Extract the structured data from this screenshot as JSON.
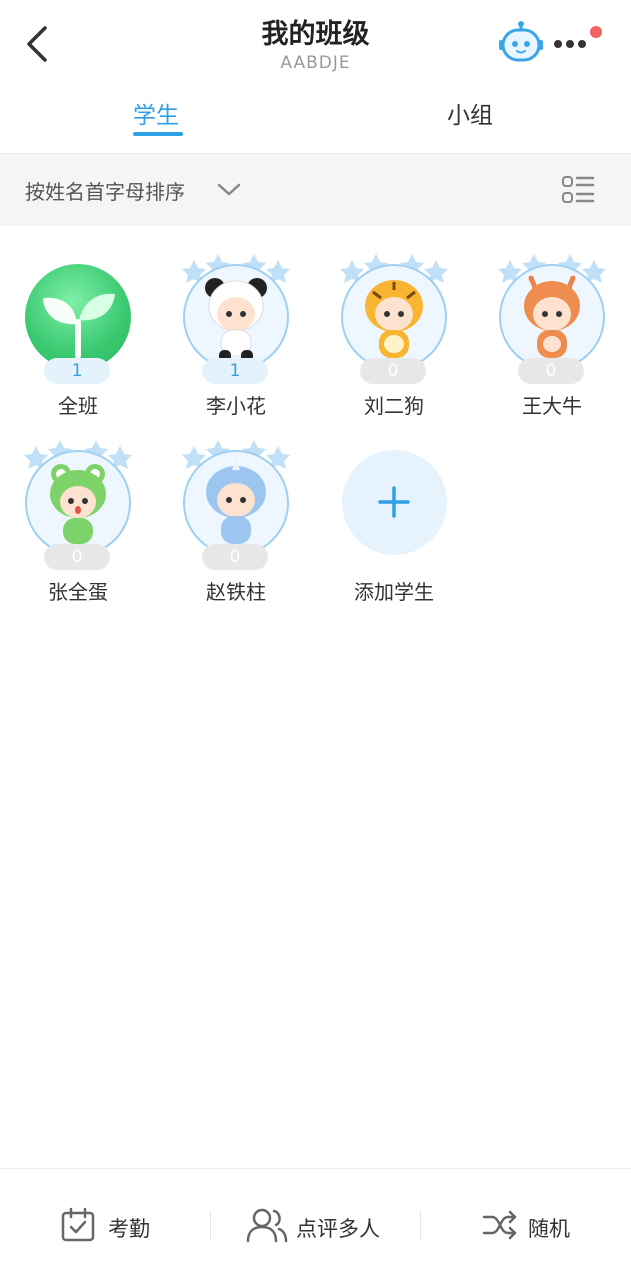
{
  "header": {
    "title": "我的班级",
    "class_code": "AABDJE",
    "robot_icon": "robot-icon",
    "more_icon": "more-icon",
    "notification_dot_color": "#f26464"
  },
  "tabs": [
    {
      "label": "学生",
      "active": true
    },
    {
      "label": "小组",
      "active": false
    }
  ],
  "sort": {
    "label": "按姓名首字母排序",
    "icon": "chevron-down-icon",
    "view_toggle_icon": "list-view-icon"
  },
  "students": [
    {
      "name": "全班",
      "score": "1",
      "avatar": "sprout-icon"
    },
    {
      "name": "李小花",
      "score": "1",
      "avatar": "panda-avatar"
    },
    {
      "name": "刘二狗",
      "score": "0",
      "avatar": "tiger-avatar"
    },
    {
      "name": "王大牛",
      "score": "0",
      "avatar": "deer-avatar"
    },
    {
      "name": "张全蛋",
      "score": "0",
      "avatar": "frog-avatar"
    },
    {
      "name": "赵铁柱",
      "score": "0",
      "avatar": "rhino-avatar"
    }
  ],
  "add_student": {
    "label": "添加学生",
    "icon": "plus-icon"
  },
  "bottom_bar": [
    {
      "label": "考勤",
      "icon": "calendar-check-icon"
    },
    {
      "label": "点评多人",
      "icon": "users-icon"
    },
    {
      "label": "随机",
      "icon": "shuffle-icon"
    }
  ],
  "colors": {
    "accent": "#2f9fe8",
    "sort_bar_bg": "#f5f5f5",
    "score_positive_bg": "#e4f2fb",
    "score_zero_bg": "#e7e7e7"
  }
}
